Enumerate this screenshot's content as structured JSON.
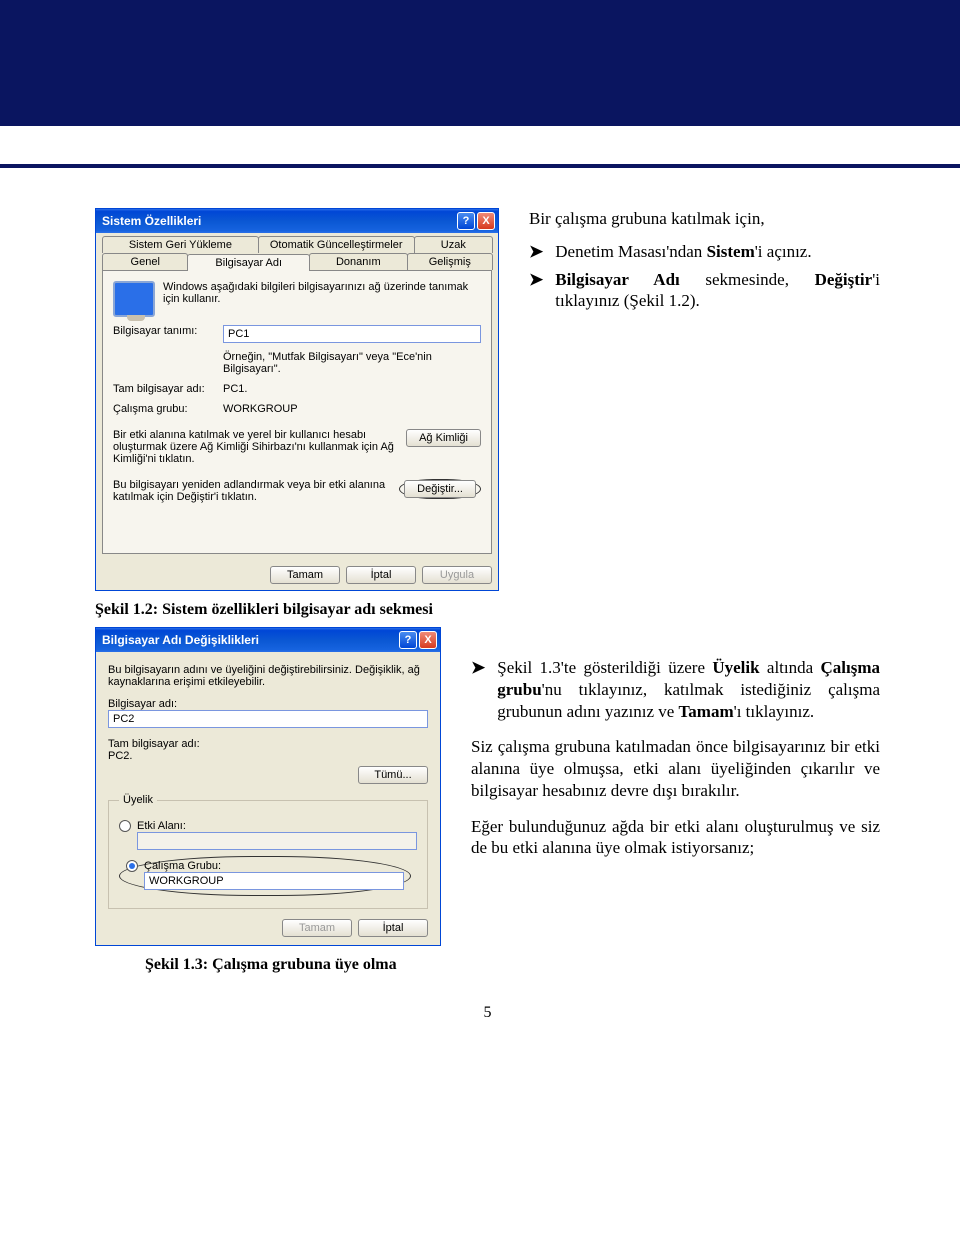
{
  "page_number": "5",
  "instructions_top": {
    "intro": "Bir çalışma grubuna katılmak için,",
    "item1_part1": "Denetim Masası",
    "item1_part2": "'ndan ",
    "item1_part3": "Sistem",
    "item1_part4": "'i açınız.",
    "item2_part1": "Bilgisayar Adı",
    "item2_part2": " sekmesinde, ",
    "item2_part3": "Değiştir",
    "item2_part4": "'i tıklayınız (Şekil 1.2)."
  },
  "win_sys": {
    "title": "Sistem Özellikleri",
    "tabs_top": [
      "Sistem Geri Yükleme",
      "Otomatik Güncelleştirmeler",
      "Uzak"
    ],
    "tabs_bot": [
      "Genel",
      "Bilgisayar Adı",
      "Donanım",
      "Gelişmiş"
    ],
    "active_tab": "Bilgisayar Adı",
    "intro_text": "Windows aşağıdaki bilgileri bilgisayarınızı ağ üzerinde tanımak için kullanır.",
    "desc_label": "Bilgisayar tanımı:",
    "desc_value": "PC1",
    "desc_example": "Örneğin, \"Mutfak Bilgisayarı\" veya \"Ece'nin Bilgisayarı\".",
    "fullname_label": "Tam bilgisayar adı:",
    "fullname_value": "PC1.",
    "workgroup_label": "Çalışma grubu:",
    "workgroup_value": "WORKGROUP",
    "netid_text": "Bir etki alanına katılmak ve yerel bir kullanıcı hesabı oluşturmak üzere Ağ Kimliği Sihirbazı'nı kullanmak için Ağ Kimliği'ni tıklatın.",
    "netid_btn": "Ağ Kimliği",
    "change_text": "Bu bilgisayarı yeniden adlandırmak veya bir etki alanına katılmak için Değiştir'i tıklatın.",
    "change_btn": "Değiştir...",
    "ok": "Tamam",
    "cancel": "İptal",
    "apply": "Uygula"
  },
  "caption1": "Şekil 1.2: Sistem özellikleri bilgisayar adı sekmesi",
  "win_name": {
    "title": "Bilgisayar Adı Değişiklikleri",
    "intro": "Bu bilgisayarın adını ve üyeliğini değiştirebilirsiniz. Değişiklik, ağ kaynaklarına erişimi etkileyebilir.",
    "name_label": "Bilgisayar adı:",
    "name_value": "PC2",
    "fullname_label": "Tam bilgisayar adı:",
    "fullname_value": "PC2.",
    "more_btn": "Tümü...",
    "membership_legend": "Üyelik",
    "domain_label": "Etki Alanı:",
    "workgroup_label": "Çalışma Grubu:",
    "workgroup_value": "WORKGROUP",
    "ok": "Tamam",
    "cancel": "İptal"
  },
  "instructions_right": {
    "item1": "Şekil 1.3'te gösterildiği üzere Üyelik altında Çalışma grubu'nu tıklayınız, katılmak istediğiniz çalışma grubunun adını yazınız ve Tamam'ı tıklayınız.",
    "p1": "Siz çalışma grubuna katılmadan önce bilgisayarınız bir etki alanına üye olmuşsa, etki alanı üyeliğinden çıkarılır ve bilgisayar hesabınız devre dışı bırakılır.",
    "p2": "Eğer bulunduğunuz ağda bir etki alanı oluşturulmuş ve siz de bu etki alanına üye olmak istiyorsanız;"
  },
  "caption2": "Şekil 1.3: Çalışma grubuna üye olma"
}
